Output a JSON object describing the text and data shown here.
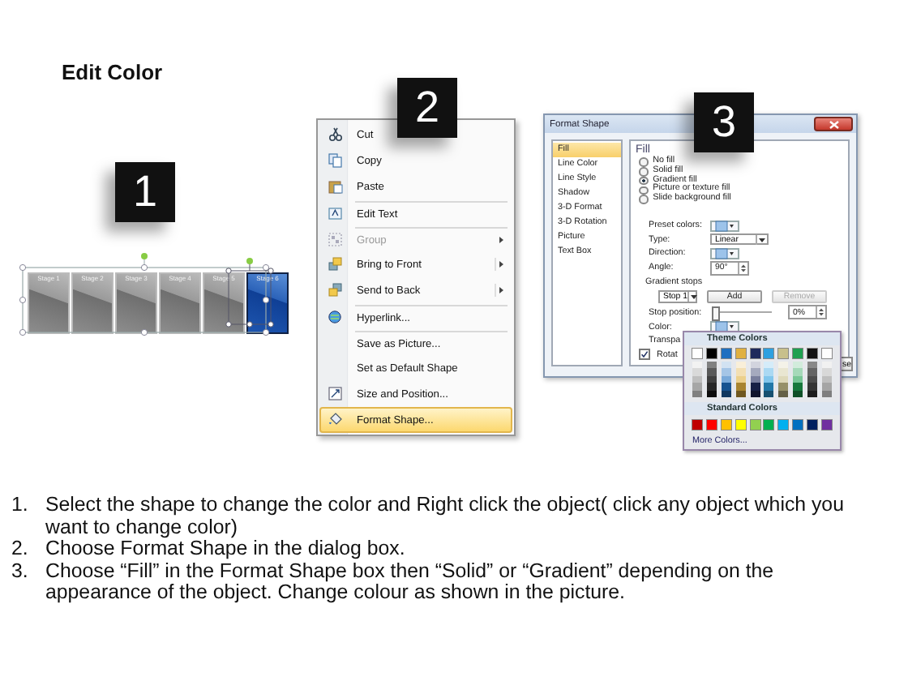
{
  "title": "Edit Color",
  "badges": [
    {
      "label": "1"
    },
    {
      "label": "2"
    },
    {
      "label": "3"
    }
  ],
  "stages": [
    {
      "label": "Stage 1",
      "selected": false
    },
    {
      "label": "Stage 2",
      "selected": false
    },
    {
      "label": "Stage 3",
      "selected": false
    },
    {
      "label": "Stage 4",
      "selected": false
    },
    {
      "label": "Stage 5",
      "selected": false
    },
    {
      "label": "Stage 6",
      "selected": true
    }
  ],
  "context_menu": [
    {
      "label": "Cut",
      "separator_before": false,
      "submenu": false,
      "disabled": false,
      "selected": false
    },
    {
      "label": "Copy",
      "separator_before": false,
      "submenu": false,
      "disabled": false,
      "selected": false
    },
    {
      "label": "Paste",
      "separator_before": false,
      "submenu": false,
      "disabled": false,
      "selected": false
    },
    {
      "label": "Edit Text",
      "separator_before": true,
      "submenu": false,
      "disabled": false,
      "selected": false
    },
    {
      "label": "Group",
      "separator_before": true,
      "submenu": true,
      "disabled": true,
      "selected": false
    },
    {
      "label": "Bring to Front",
      "separator_before": false,
      "submenu": true,
      "disabled": false,
      "selected": false
    },
    {
      "label": "Send to Back",
      "separator_before": false,
      "submenu": true,
      "disabled": false,
      "selected": false
    },
    {
      "label": "Hyperlink...",
      "separator_before": true,
      "submenu": false,
      "disabled": false,
      "selected": false
    },
    {
      "label": "Save as Picture...",
      "separator_before": true,
      "submenu": false,
      "disabled": false,
      "selected": false
    },
    {
      "label": "Set as Default Shape",
      "separator_before": false,
      "submenu": false,
      "disabled": false,
      "selected": false
    },
    {
      "label": "Size and Position...",
      "separator_before": false,
      "submenu": false,
      "disabled": false,
      "selected": false
    },
    {
      "label": "Format Shape...",
      "separator_before": false,
      "submenu": false,
      "disabled": false,
      "selected": true
    }
  ],
  "format_shape": {
    "title": "Format Shape",
    "categories": [
      {
        "label": "Fill",
        "selected": true
      },
      {
        "label": "Line Color",
        "selected": false
      },
      {
        "label": "Line Style",
        "selected": false
      },
      {
        "label": "Shadow",
        "selected": false
      },
      {
        "label": "3-D Format",
        "selected": false
      },
      {
        "label": "3-D Rotation",
        "selected": false
      },
      {
        "label": "Picture",
        "selected": false
      },
      {
        "label": "Text Box",
        "selected": false
      }
    ],
    "heading": "Fill",
    "fill_options": [
      {
        "label": "No fill",
        "selected": false
      },
      {
        "label": "Solid fill",
        "selected": false
      },
      {
        "label": "Gradient fill",
        "selected": true
      },
      {
        "label": "Picture or texture fill",
        "selected": false
      },
      {
        "label": "Slide background fill",
        "selected": false
      }
    ],
    "fields": [
      {
        "kind": "swatch",
        "label": "Preset colors:"
      },
      {
        "kind": "dropdown",
        "label": "Type:",
        "value": "Linear"
      },
      {
        "kind": "swatch",
        "label": "Direction:"
      },
      {
        "kind": "spinner",
        "label": "Angle:",
        "value": "90°"
      },
      {
        "kind": "heading",
        "label": "Gradient stops"
      },
      {
        "kind": "stops",
        "value": "Stop 1",
        "buttons": [
          {
            "label": "Add",
            "disabled": false
          },
          {
            "label": "Remove",
            "disabled": true
          }
        ]
      },
      {
        "kind": "slider",
        "label": "Stop position:",
        "level": 0,
        "value": "0%"
      },
      {
        "kind": "color",
        "label": "Color:"
      },
      {
        "kind": "plain",
        "label": "Transpa"
      },
      {
        "kind": "checkbox",
        "label": "Rotat",
        "checked": true
      }
    ],
    "footer_button": "se"
  },
  "color_popup": {
    "theme_heading": "Theme Colors",
    "theme_colors": [
      {
        "color": "#ffffff"
      },
      {
        "color": "#000000"
      },
      {
        "color": "#1f6fc0"
      },
      {
        "color": "#e0b040"
      },
      {
        "color": "#1f2a5c"
      },
      {
        "color": "#2ea0e0"
      },
      {
        "color": "#c8c08c"
      },
      {
        "color": "#1ea050"
      },
      {
        "color": "#111111"
      },
      {
        "color": "#fefefe"
      }
    ],
    "standard_heading": "Standard Colors",
    "standard_colors": [
      {
        "color": "#c00000"
      },
      {
        "color": "#ff0000"
      },
      {
        "color": "#ffc000"
      },
      {
        "color": "#ffff00"
      },
      {
        "color": "#92d050"
      },
      {
        "color": "#00b050"
      },
      {
        "color": "#00b0f0"
      },
      {
        "color": "#0070c0"
      },
      {
        "color": "#002060"
      },
      {
        "color": "#7030a0"
      }
    ],
    "more_colors": "More Colors..."
  },
  "steps": [
    {
      "number": "1.",
      "text": "Select the shape to change the color and Right click the object( click any object which you want to change color)"
    },
    {
      "number": "2.",
      "text": "Choose Format Shape in the dialog box."
    },
    {
      "number": "3.",
      "text": "Choose “Fill” in the Format Shape box then “Solid” or “Gradient” depending on the appearance of the object. Change colour as shown in the picture."
    }
  ]
}
